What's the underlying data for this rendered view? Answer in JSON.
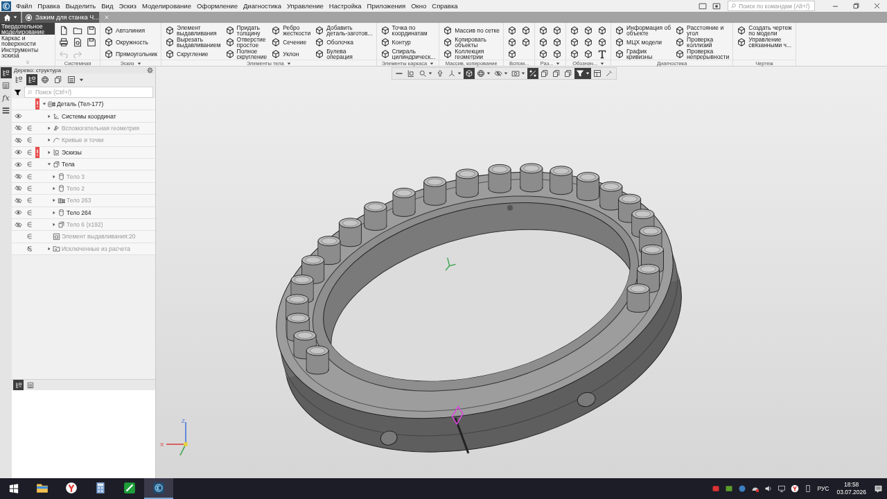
{
  "menu": [
    "Файл",
    "Правка",
    "Выделить",
    "Вид",
    "Эскиз",
    "Моделирование",
    "Оформление",
    "Диагностика",
    "Управление",
    "Настройка",
    "Приложения",
    "Окно",
    "Справка"
  ],
  "command_search": {
    "placeholder": "Поиск по командам (Alt+/)"
  },
  "doc_tabs": [
    {
      "label": "Зажим для станка Ч...",
      "selected": true
    }
  ],
  "ribbon": {
    "modes": [
      {
        "label": "Твердотельное\nмоделирование",
        "selected": true
      },
      {
        "label": "Каркас и\nповерхности",
        "selected": false
      },
      {
        "label": "Инструменты\nэскиза",
        "selected": false
      }
    ],
    "groups": [
      {
        "label": "Системная",
        "menu": false,
        "items": [
          {
            "kind": "new",
            "disabled": false
          },
          {
            "kind": "print",
            "disabled": false
          },
          {
            "kind": "undo",
            "disabled": true
          },
          {
            "kind": "open",
            "disabled": false
          },
          {
            "kind": "preview",
            "disabled": false
          },
          {
            "kind": "redo",
            "disabled": true
          },
          {
            "kind": "save",
            "disabled": false
          },
          {
            "kind": "save",
            "disabled": false
          }
        ]
      },
      {
        "label": "Эскиз",
        "menu": true,
        "items": [
          {
            "label": "Автолиния"
          },
          {
            "label": "Окружность"
          },
          {
            "label": "Прямоугольник"
          }
        ]
      },
      {
        "label": "Элементы тела",
        "menu": true,
        "items": [
          {
            "label": "Элемент\nвыдавливания"
          },
          {
            "label": "Вырезать\nвыдавливанием"
          },
          {
            "label": "Скругление"
          },
          {
            "label": "Придать\nтолщину"
          },
          {
            "label": "Отверстие\nпростое"
          },
          {
            "label": "Полное\nскругление"
          },
          {
            "label": "Ребро\nжесткости"
          },
          {
            "label": "Сечение"
          },
          {
            "label": "Уклон"
          },
          {
            "label": "Добавить\nдеталь-заготов..."
          },
          {
            "label": "Оболочка"
          },
          {
            "label": "Булева\nоперация"
          }
        ]
      },
      {
        "label": "Элементы каркаса",
        "menu": true,
        "items": [
          {
            "label": "Точка по\nкоординатам"
          },
          {
            "label": "Контур"
          },
          {
            "label": "Спираль\nцилиндрическ..."
          }
        ]
      },
      {
        "label": "Массив, копирование",
        "menu": false,
        "items": [
          {
            "label": "Массив по сетке"
          },
          {
            "label": "Копировать\nобъекты"
          },
          {
            "label": "Коллекция\nгеометрии"
          }
        ]
      },
      {
        "label": "Вспом...",
        "menu": false,
        "items": [
          {
            "kind": "tool"
          },
          {
            "kind": "tool"
          },
          {
            "kind": "tool"
          },
          {
            "kind": "tool"
          },
          {
            "kind": "tool"
          }
        ]
      },
      {
        "label": "Раз...",
        "menu": true,
        "items": [
          {
            "kind": "tool"
          },
          {
            "kind": "tool"
          },
          {
            "kind": "tool"
          },
          {
            "kind": "tool"
          },
          {
            "kind": "tool"
          },
          {
            "kind": "tool"
          }
        ]
      },
      {
        "label": "Обознач...",
        "menu": true,
        "items": [
          {
            "kind": "tool"
          },
          {
            "kind": "tool"
          },
          {
            "kind": "tool"
          },
          {
            "kind": "tool"
          },
          {
            "kind": "tool"
          },
          {
            "kind": "tool"
          },
          {
            "kind": "tool"
          },
          {
            "kind": "tool"
          },
          {
            "kind": "text"
          }
        ]
      },
      {
        "label": "Диагностика",
        "menu": false,
        "items": [
          {
            "label": "Информация об\nобъекте"
          },
          {
            "label": "МЦХ модели"
          },
          {
            "label": "График\nкривизны"
          },
          {
            "label": "Расстояние и\nугол"
          },
          {
            "label": "Проверка\nколлизий"
          },
          {
            "label": "Проверка\nнепрерывности"
          }
        ]
      },
      {
        "label": "Чертеж",
        "menu": false,
        "items": [
          {
            "label": "Создать чертеж\nпо модели"
          },
          {
            "label": "Управление\nсвязанными ч..."
          }
        ]
      }
    ]
  },
  "side_tools": [
    {
      "kind": "tree",
      "selected": true
    },
    {
      "kind": "list",
      "selected": false
    },
    {
      "kind": "fx",
      "label": "fx",
      "selected": false
    },
    {
      "kind": "menu",
      "selected": false
    }
  ],
  "tree_panel": {
    "title": "Дерево: структура",
    "search": {
      "placeholder": "Поиск (Ctrl+/)"
    },
    "tree": [
      {
        "label": "Деталь (Тел-177)",
        "kind": "part",
        "expanded": true,
        "error": true,
        "dimmed": false,
        "children": [
          {
            "label": "Системы координат",
            "kind": "coords",
            "visible": true,
            "expanded": false,
            "error": false,
            "dimmed": false
          },
          {
            "label": "Вспомогательная геометрия",
            "kind": "geometry",
            "visible": false,
            "in_calc": true,
            "expanded": false,
            "error": false,
            "dimmed": true
          },
          {
            "label": "Кривые и точки",
            "kind": "curves",
            "visible": false,
            "in_calc": true,
            "expanded": false,
            "error": false,
            "dimmed": true
          },
          {
            "label": "Эскизы",
            "kind": "sketches",
            "visible": true,
            "in_calc": true,
            "expanded": false,
            "error": true,
            "dimmed": false
          },
          {
            "label": "Тела",
            "kind": "bodies",
            "visible": true,
            "in_calc": true,
            "expanded": true,
            "error": false,
            "dimmed": false,
            "children": [
              {
                "label": "Тело 3",
                "kind": "body",
                "visible": false,
                "in_calc": true,
                "expanded": false,
                "error": false,
                "dimmed": true
              },
              {
                "label": "Тело 2",
                "kind": "body",
                "visible": false,
                "in_calc": true,
                "expanded": false,
                "error": false,
                "dimmed": true
              },
              {
                "label": "Тело 263",
                "kind": "body-array",
                "visible": false,
                "in_calc": true,
                "expanded": false,
                "error": false,
                "dimmed": true
              },
              {
                "label": "Тело 264",
                "kind": "body",
                "visible": true,
                "in_calc": true,
                "expanded": false,
                "error": false,
                "dimmed": false
              },
              {
                "label": "Тело 6 (x192)",
                "kind": "bodies",
                "visible": false,
                "in_calc": true,
                "expanded": false,
                "error": false,
                "dimmed": true
              }
            ]
          },
          {
            "label": "Элемент выдавливания:20",
            "kind": "feature",
            "in_calc": true,
            "error": false,
            "dimmed": true
          },
          {
            "label": "Исключенные из расчета",
            "kind": "folder",
            "in_calc": false,
            "expanded": false,
            "error": false,
            "dimmed": true
          }
        ]
      }
    ]
  },
  "panel_tabs": [
    {
      "kind": "tree",
      "selected": true
    },
    {
      "kind": "list",
      "selected": false
    }
  ],
  "view_toolbar": [
    {
      "kind": "grip",
      "selected": false,
      "menu": false
    },
    {
      "kind": "sketch",
      "selected": false,
      "menu": false
    },
    {
      "kind": "zoom",
      "selected": false,
      "menu": true
    },
    {
      "kind": "pan",
      "selected": false,
      "menu": false
    },
    {
      "kind": "axes",
      "selected": false,
      "menu": true
    },
    {
      "kind": "cube",
      "selected": true,
      "menu": false
    },
    {
      "kind": "mesh",
      "selected": false,
      "menu": true
    },
    {
      "kind": "hide",
      "selected": false,
      "menu": true
    },
    {
      "kind": "photo",
      "selected": false,
      "menu": true
    },
    {
      "kind": "snap",
      "selected": true,
      "menu": false
    },
    {
      "kind": "layers",
      "selected": false,
      "menu": false
    },
    {
      "kind": "layers",
      "selected": false,
      "menu": false
    },
    {
      "kind": "layers",
      "selected": false,
      "menu": false
    },
    {
      "kind": "filter",
      "selected": true,
      "menu": true
    },
    {
      "kind": "panel",
      "selected": false,
      "menu": false
    },
    {
      "kind": "pipette",
      "selected": false,
      "menu": false
    }
  ],
  "axis_labels": [
    "Z",
    "X"
  ],
  "taskbar": {
    "apps": [
      {
        "kind": "folder",
        "selected": false
      },
      {
        "kind": "browser",
        "selected": false
      },
      {
        "kind": "calculator",
        "selected": false
      },
      {
        "kind": "pen",
        "selected": false
      },
      {
        "kind": "cad",
        "selected": true
      }
    ],
    "language": "РУС",
    "time": "18:58",
    "date": "03.07.2026"
  }
}
